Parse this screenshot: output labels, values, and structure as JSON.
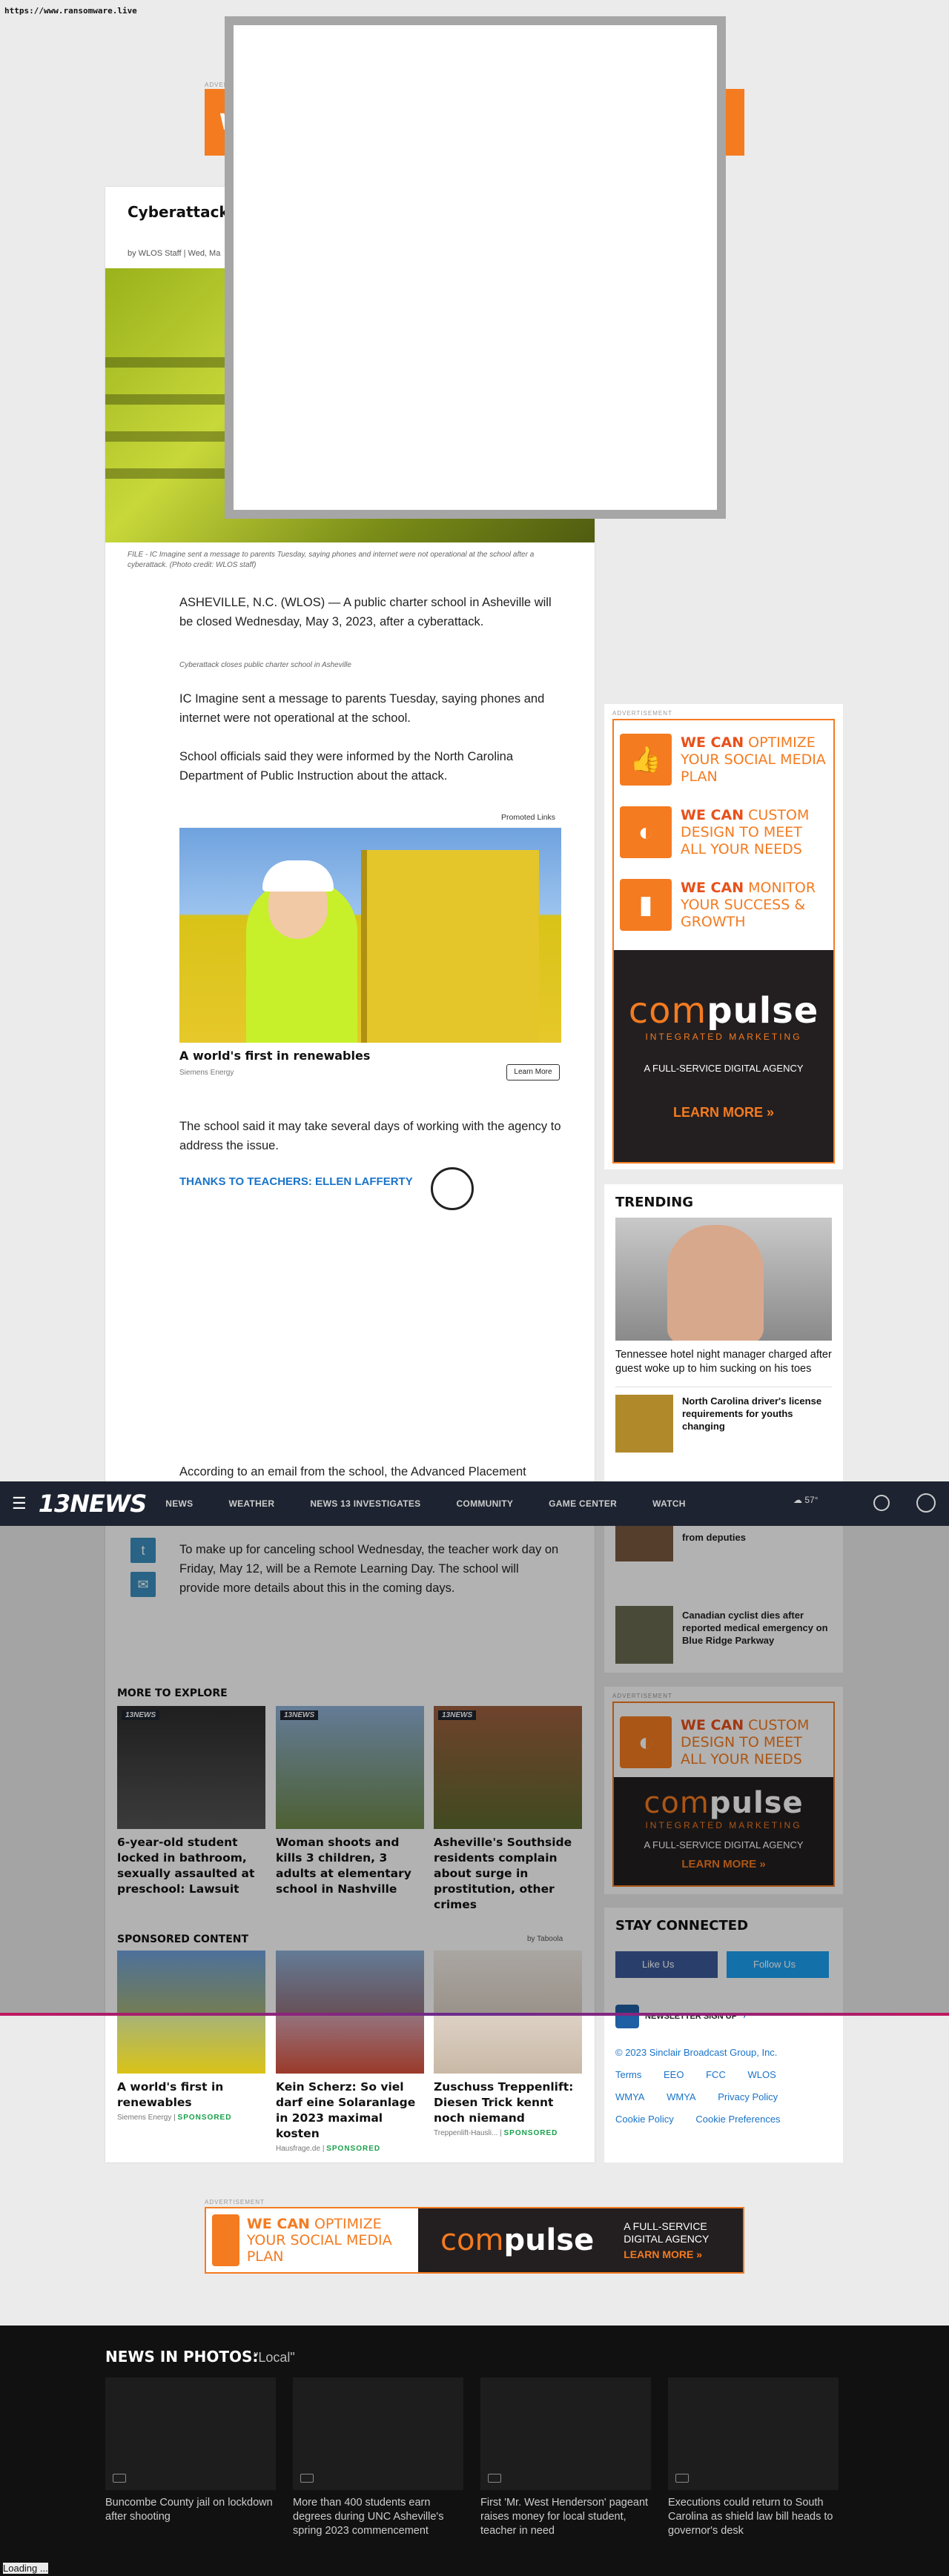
{
  "browser": {
    "url": "https://www.ransomware.live"
  },
  "ads": {
    "label": "ADVERTISEMENT",
    "top_banner_text": "WE",
    "pitches": [
      {
        "bold": "WE CAN",
        "text": " OPTIMIZE YOUR SOCIAL MEDIA PLAN"
      },
      {
        "bold": "WE CAN",
        "text": " CUSTOM DESIGN TO MEET ALL YOUR NEEDS"
      },
      {
        "bold": "WE CAN",
        "text": " MONITOR YOUR SUCCESS & GROWTH"
      }
    ],
    "brand_pre": "com",
    "brand_post": "pulse",
    "brand_tagline": "INTEGRATED MARKETING",
    "full_service": "A FULL-SERVICE DIGITAL AGENCY",
    "learn_more": "LEARN MORE »",
    "small_pitch_bold": "WE CAN",
    "small_pitch_text": " CUSTOM DESIGN TO MEET ALL YOUR NEEDS",
    "bottom_pitch_bold": "WE CAN",
    "bottom_pitch_text": " OPTIMIZE YOUR SOCIAL MEDIA PLAN",
    "bottom_full_service": "A FULL-SERVICE DIGITAL AGENCY"
  },
  "article": {
    "headline": "Cyberattack",
    "byline": "by WLOS Staff | Wed, Ma",
    "caption": "FILE - IC Imagine sent a message to parents Tuesday, saying phones and internet were not operational at the school after a cyberattack. (Photo credit: WLOS staff)",
    "p1": "ASHEVILLE, N.C. (WLOS) — A public charter school in Asheville will be closed Wednesday, May 3, 2023, after a cyberattack.",
    "embed_caption": "Cyberattack closes public charter school in Asheville",
    "p2": "IC Imagine sent a message to parents Tuesday, saying phones and internet were not operational at the school.",
    "p3": "School officials said they were informed by the North Carolina Department of Public Instruction about the attack.",
    "promoted_label": "Promoted Links",
    "promo_title": "A world's first in renewables",
    "promo_source": "Siemens Energy",
    "promo_button": "Learn More",
    "p4": "The school said it may take several days of working with the agency to address the issue.",
    "related_link": "THANKS TO TEACHERS: ELLEN LAFFERTY",
    "p5": "According to an email from the school, the Advanced Placement",
    "p6": "To make up for canceling school Wednesday, the teacher work day on Friday, May 12, will be a Remote Learning Day. The school will provide more details about this in the coming days."
  },
  "nav": {
    "logo": "13NEWS",
    "items": [
      "NEWS",
      "WEATHER",
      "NEWS 13 INVESTIGATES",
      "COMMUNITY",
      "GAME CENTER",
      "WATCH"
    ],
    "temp": "57°"
  },
  "trending": {
    "title": "TRENDING",
    "lead_title": "Tennessee hotel night manager charged after guest woke up to him sucking on his toes",
    "items": [
      {
        "title": "North Carolina driver's license requirements for youths changing"
      },
      {
        "title": "from deputies"
      },
      {
        "title": "Canadian cyclist dies after reported medical emergency on Blue Ridge Parkway"
      }
    ]
  },
  "stay_connected": {
    "title": "STAY CONNECTED",
    "facebook": "Like Us",
    "twitter": "Follow Us",
    "newsletter": "NEWSLETTER SIGN UP",
    "copyright": "© 2023 Sinclair Broadcast Group, Inc.",
    "links": [
      "Terms",
      "EEO",
      "FCC",
      "WLOS",
      "WMYA",
      "WMYA",
      "Privacy Policy",
      "Cookie Policy",
      "Cookie Preferences"
    ]
  },
  "explore": {
    "title": "MORE TO EXPLORE",
    "badge": "13NEWS",
    "cards": [
      {
        "title": "6-year-old student locked in bathroom, sexually assaulted at preschool: Lawsuit"
      },
      {
        "title": "Woman shoots and kills 3 children, 3 adults at elementary school in Nashville"
      },
      {
        "title": "Asheville's Southside residents complain about surge in prostitution, other crimes"
      }
    ]
  },
  "sponsored": {
    "title": "SPONSORED CONTENT",
    "by": "by Taboola",
    "tag": "SPONSORED",
    "cards": [
      {
        "title": "A world's first in renewables",
        "source": "Siemens Energy"
      },
      {
        "title": "Kein Scherz: So viel darf eine Solaranlage in 2023 maximal kosten",
        "source": "Hausfrage.de"
      },
      {
        "title": "Zuschuss Treppenlift: Diesen Trick kennt noch niemand",
        "source": "Treppenlift-Hausli..."
      }
    ]
  },
  "photos": {
    "title": "NEWS IN PHOTOS:",
    "subtitle": "\"Local\"",
    "items": [
      {
        "title": "Buncombe County jail on lockdown after shooting"
      },
      {
        "title": "More than 400 students earn degrees during UNC Asheville's spring 2023 commencement"
      },
      {
        "title": "First 'Mr. West Henderson' pageant raises money for local student, teacher in need"
      },
      {
        "title": "Executions could return to South Carolina as shield law bill heads to governor's desk"
      }
    ]
  },
  "status": {
    "loading": "Loading ..."
  }
}
